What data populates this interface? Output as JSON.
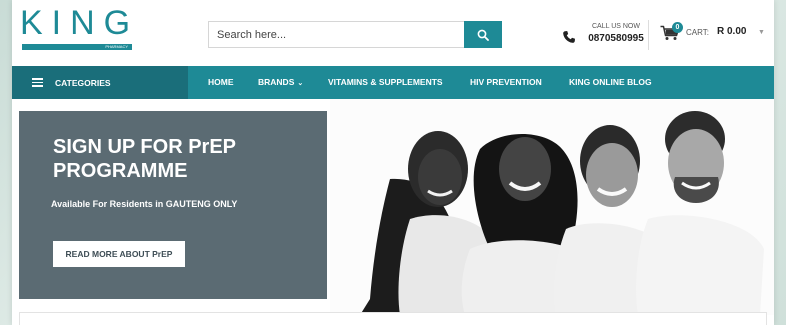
{
  "brand": {
    "name": "KING",
    "tagline": "PHARMACY"
  },
  "search": {
    "placeholder": "Search here...",
    "icon": "search-icon"
  },
  "call": {
    "label": "CALL US NOW",
    "number": "0870580995",
    "icon": "phone-icon"
  },
  "cart": {
    "badge": "0",
    "label": "CART:",
    "amount": "R 0.00",
    "icon": "cart-icon"
  },
  "nav": {
    "categories_label": "CATEGORIES",
    "items": [
      {
        "label": "HOME"
      },
      {
        "label": "BRANDS",
        "has_dropdown": true
      },
      {
        "label": "VITAMINS & SUPPLEMENTS"
      },
      {
        "label": "HIV PREVENTION"
      },
      {
        "label": "KING ONLINE BLOG"
      }
    ]
  },
  "hero": {
    "title_line1": "SIGN UP FOR PrEP",
    "title_line2": "PROGRAMME",
    "subtitle": "Available For Residents in GAUTENG ONLY",
    "button_label": "READ MORE ABOUT PrEP"
  },
  "colors": {
    "brand_teal": "#1e8a96",
    "nav_dark": "#1a6e7a",
    "promo_bg": "#5b6b73"
  }
}
